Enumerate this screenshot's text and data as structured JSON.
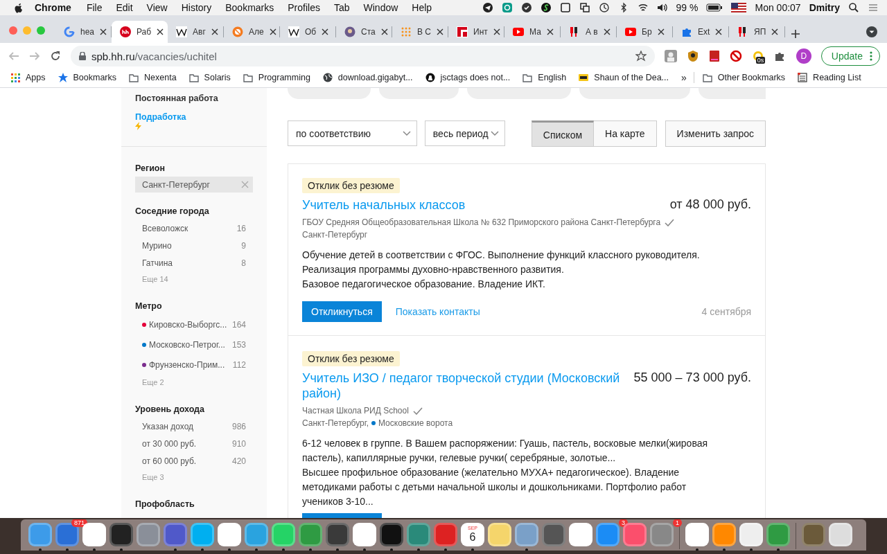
{
  "menu_bar": {
    "app": "Chrome",
    "menus": [
      "File",
      "Edit",
      "View",
      "History",
      "Bookmarks",
      "Profiles",
      "Tab",
      "Window",
      "Help"
    ],
    "battery": "99 %",
    "clock": "Mon 00:07",
    "user": "Dmitry"
  },
  "tabs": [
    {
      "title": "hea",
      "selected": false
    },
    {
      "title": "Раб",
      "selected": true
    },
    {
      "title": "Авг",
      "selected": false
    },
    {
      "title": "Але",
      "selected": false
    },
    {
      "title": "Об",
      "selected": false
    },
    {
      "title": "Ста",
      "selected": false
    },
    {
      "title": "В С",
      "selected": false
    },
    {
      "title": "Инт",
      "selected": false
    },
    {
      "title": "Ма",
      "selected": false
    },
    {
      "title": "А в",
      "selected": false
    },
    {
      "title": "Бр",
      "selected": false
    },
    {
      "title": "Ext",
      "selected": false
    },
    {
      "title": "ЯП",
      "selected": false
    }
  ],
  "toolbar": {
    "url_host": "spb.hh.ru",
    "url_path": "/vacancies/uchitel",
    "extension_badge": "0s",
    "profile_initial": "D",
    "update": "Update"
  },
  "bookmarks": [
    {
      "kind": "apps",
      "label": "Apps"
    },
    {
      "kind": "star",
      "label": "Bookmarks"
    },
    {
      "kind": "folder",
      "label": "Nexenta"
    },
    {
      "kind": "folder",
      "label": "Solaris"
    },
    {
      "kind": "folder",
      "label": "Programming"
    },
    {
      "kind": "globe",
      "label": "download.gigabyt..."
    },
    {
      "kind": "github",
      "label": "jsctags does not..."
    },
    {
      "kind": "folder",
      "label": "English"
    },
    {
      "kind": "imdb",
      "label": "Shaun of the Dea..."
    },
    {
      "kind": "more",
      "label": "»"
    },
    {
      "kind": "folder",
      "label": "Other Bookmarks"
    },
    {
      "kind": "reading",
      "label": "Reading List"
    }
  ],
  "sidebar": {
    "employment": [
      {
        "label": "Постоянная работа",
        "selected": true
      },
      {
        "label": "Подработка",
        "selected": false
      }
    ],
    "sections": [
      {
        "kind": "chip",
        "title": "Регион",
        "chip": "Санкт-Петербург"
      },
      {
        "kind": "list",
        "title": "Соседние города",
        "items": [
          {
            "label": "Всеволожск",
            "count": "16"
          },
          {
            "label": "Мурино",
            "count": "9"
          },
          {
            "label": "Гатчина",
            "count": "8"
          }
        ],
        "more": "Еще 14"
      },
      {
        "kind": "list",
        "title": "Метро",
        "items": [
          {
            "label": "Кировско-Выборгс...",
            "count": "164",
            "color": "#e4003a"
          },
          {
            "label": "Московско-Петрог...",
            "count": "153",
            "color": "#0078c9"
          },
          {
            "label": "Фрунзенско-Прим...",
            "count": "112",
            "color": "#7b2d8e"
          }
        ],
        "more": "Еще 2"
      },
      {
        "kind": "list",
        "title": "Уровень дохода",
        "items": [
          {
            "label": "Указан доход",
            "count": "986"
          },
          {
            "label": "от 30 000 руб.",
            "count": "910"
          },
          {
            "label": "от 60 000 руб.",
            "count": "420"
          }
        ],
        "more": "Еще 3"
      },
      {
        "kind": "title",
        "title": "Профобласть"
      }
    ]
  },
  "main": {
    "sort": "по соответствию",
    "period": "весь период",
    "view": [
      {
        "label": "Списком",
        "selected": true
      },
      {
        "label": "На карте",
        "selected": false
      }
    ],
    "edit_query": "Изменить запрос",
    "vacancies": [
      {
        "badge": "Отклик без резюме",
        "title": "Учитель начальных классов",
        "salary": "от 48 000 руб.",
        "company": "ГБОУ Средняя Общеобразовательная Школа № 632 Приморского района Санкт-Петербурга",
        "verified": true,
        "location": "Санкт-Петербург",
        "description": [
          "Обучение детей в соответствии с ФГОС. Выполнение функций классного руководителя.",
          "Реализация программы духовно-нравственного развития.",
          "Базовое педагогическое образование. Владение ИКТ."
        ],
        "apply": "Откликнуться",
        "contacts": "Показать контакты",
        "date": "4 сентября"
      },
      {
        "badge": "Отклик без резюме",
        "title": "Учитель ИЗО / педагог творческой студии (Московский район)",
        "salary": "55 000 – 73 000 руб.",
        "company": "Частная Школа РИД School",
        "verified": true,
        "location": "Санкт-Петербург,",
        "metro": {
          "name": "Московские ворота",
          "color": "#0078c9"
        },
        "description": [
          "6-12 человек в группе. В Вашем распоряжении: Гуашь, пастель, восковые мелки(жировая пастель), капиллярные ручки, гелевые ручки( серебряные, золотые...",
          "Высшее профильное образование (желательно МУХА+ педагогическое). Владение методиками работы с детьми начальной школы и дошкольниками. Портфолио работ учеников 3-10..."
        ]
      }
    ]
  },
  "dock": [
    {
      "kind": "finder",
      "running": true
    },
    {
      "kind": "mail",
      "running": true,
      "badge": "871"
    },
    {
      "kind": "chrome",
      "running": true
    },
    {
      "kind": "terminal",
      "running": true
    },
    {
      "kind": "rocket",
      "running": false
    },
    {
      "kind": "teams",
      "running": true
    },
    {
      "kind": "skype",
      "running": true
    },
    {
      "kind": "slack",
      "running": true
    },
    {
      "kind": "telegram",
      "running": true
    },
    {
      "kind": "whatsapp",
      "running": true
    },
    {
      "kind": "vim",
      "running": true
    },
    {
      "kind": "sublime",
      "running": true
    },
    {
      "kind": "hook",
      "running": true
    },
    {
      "kind": "pycharm",
      "running": true
    },
    {
      "kind": "vpn",
      "running": true
    },
    {
      "kind": "parallels",
      "running": true
    },
    {
      "kind": "calendar",
      "running": true,
      "month": "SEP",
      "day": "6"
    },
    {
      "kind": "notes",
      "running": false
    },
    {
      "kind": "preview",
      "running": true
    },
    {
      "kind": "calculator",
      "running": false
    },
    {
      "kind": "reminders",
      "running": false
    },
    {
      "kind": "appstore",
      "running": false,
      "badge": "3"
    },
    {
      "kind": "music",
      "running": false
    },
    {
      "kind": "prefs",
      "running": false,
      "badge": "1"
    },
    {
      "kind": "sep"
    },
    {
      "kind": "eset",
      "running": true
    },
    {
      "kind": "vlc",
      "running": true
    },
    {
      "kind": "file",
      "running": true
    },
    {
      "kind": "vim",
      "running": true
    },
    {
      "kind": "sep"
    },
    {
      "kind": "image",
      "running": false
    },
    {
      "kind": "trash",
      "running": false
    }
  ]
}
